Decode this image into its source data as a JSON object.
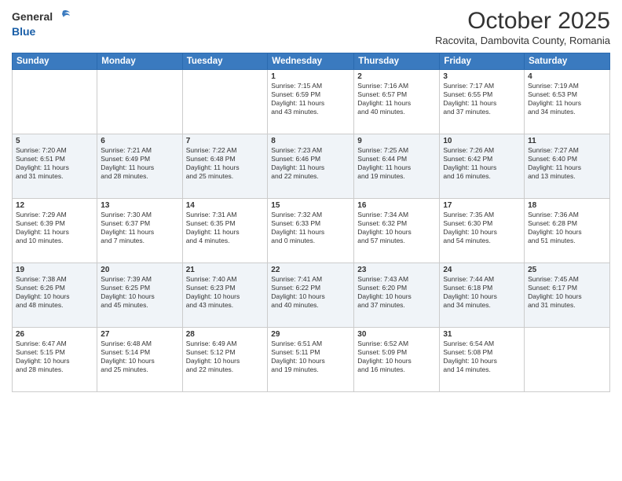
{
  "header": {
    "logo_line1": "General",
    "logo_line2": "Blue",
    "month": "October 2025",
    "location": "Racovita, Dambovita County, Romania"
  },
  "days_of_week": [
    "Sunday",
    "Monday",
    "Tuesday",
    "Wednesday",
    "Thursday",
    "Friday",
    "Saturday"
  ],
  "weeks": [
    [
      {
        "day": "",
        "info": ""
      },
      {
        "day": "",
        "info": ""
      },
      {
        "day": "",
        "info": ""
      },
      {
        "day": "1",
        "info": "Sunrise: 7:15 AM\nSunset: 6:59 PM\nDaylight: 11 hours\nand 43 minutes."
      },
      {
        "day": "2",
        "info": "Sunrise: 7:16 AM\nSunset: 6:57 PM\nDaylight: 11 hours\nand 40 minutes."
      },
      {
        "day": "3",
        "info": "Sunrise: 7:17 AM\nSunset: 6:55 PM\nDaylight: 11 hours\nand 37 minutes."
      },
      {
        "day": "4",
        "info": "Sunrise: 7:19 AM\nSunset: 6:53 PM\nDaylight: 11 hours\nand 34 minutes."
      }
    ],
    [
      {
        "day": "5",
        "info": "Sunrise: 7:20 AM\nSunset: 6:51 PM\nDaylight: 11 hours\nand 31 minutes."
      },
      {
        "day": "6",
        "info": "Sunrise: 7:21 AM\nSunset: 6:49 PM\nDaylight: 11 hours\nand 28 minutes."
      },
      {
        "day": "7",
        "info": "Sunrise: 7:22 AM\nSunset: 6:48 PM\nDaylight: 11 hours\nand 25 minutes."
      },
      {
        "day": "8",
        "info": "Sunrise: 7:23 AM\nSunset: 6:46 PM\nDaylight: 11 hours\nand 22 minutes."
      },
      {
        "day": "9",
        "info": "Sunrise: 7:25 AM\nSunset: 6:44 PM\nDaylight: 11 hours\nand 19 minutes."
      },
      {
        "day": "10",
        "info": "Sunrise: 7:26 AM\nSunset: 6:42 PM\nDaylight: 11 hours\nand 16 minutes."
      },
      {
        "day": "11",
        "info": "Sunrise: 7:27 AM\nSunset: 6:40 PM\nDaylight: 11 hours\nand 13 minutes."
      }
    ],
    [
      {
        "day": "12",
        "info": "Sunrise: 7:29 AM\nSunset: 6:39 PM\nDaylight: 11 hours\nand 10 minutes."
      },
      {
        "day": "13",
        "info": "Sunrise: 7:30 AM\nSunset: 6:37 PM\nDaylight: 11 hours\nand 7 minutes."
      },
      {
        "day": "14",
        "info": "Sunrise: 7:31 AM\nSunset: 6:35 PM\nDaylight: 11 hours\nand 4 minutes."
      },
      {
        "day": "15",
        "info": "Sunrise: 7:32 AM\nSunset: 6:33 PM\nDaylight: 11 hours\nand 0 minutes."
      },
      {
        "day": "16",
        "info": "Sunrise: 7:34 AM\nSunset: 6:32 PM\nDaylight: 10 hours\nand 57 minutes."
      },
      {
        "day": "17",
        "info": "Sunrise: 7:35 AM\nSunset: 6:30 PM\nDaylight: 10 hours\nand 54 minutes."
      },
      {
        "day": "18",
        "info": "Sunrise: 7:36 AM\nSunset: 6:28 PM\nDaylight: 10 hours\nand 51 minutes."
      }
    ],
    [
      {
        "day": "19",
        "info": "Sunrise: 7:38 AM\nSunset: 6:26 PM\nDaylight: 10 hours\nand 48 minutes."
      },
      {
        "day": "20",
        "info": "Sunrise: 7:39 AM\nSunset: 6:25 PM\nDaylight: 10 hours\nand 45 minutes."
      },
      {
        "day": "21",
        "info": "Sunrise: 7:40 AM\nSunset: 6:23 PM\nDaylight: 10 hours\nand 43 minutes."
      },
      {
        "day": "22",
        "info": "Sunrise: 7:41 AM\nSunset: 6:22 PM\nDaylight: 10 hours\nand 40 minutes."
      },
      {
        "day": "23",
        "info": "Sunrise: 7:43 AM\nSunset: 6:20 PM\nDaylight: 10 hours\nand 37 minutes."
      },
      {
        "day": "24",
        "info": "Sunrise: 7:44 AM\nSunset: 6:18 PM\nDaylight: 10 hours\nand 34 minutes."
      },
      {
        "day": "25",
        "info": "Sunrise: 7:45 AM\nSunset: 6:17 PM\nDaylight: 10 hours\nand 31 minutes."
      }
    ],
    [
      {
        "day": "26",
        "info": "Sunrise: 6:47 AM\nSunset: 5:15 PM\nDaylight: 10 hours\nand 28 minutes."
      },
      {
        "day": "27",
        "info": "Sunrise: 6:48 AM\nSunset: 5:14 PM\nDaylight: 10 hours\nand 25 minutes."
      },
      {
        "day": "28",
        "info": "Sunrise: 6:49 AM\nSunset: 5:12 PM\nDaylight: 10 hours\nand 22 minutes."
      },
      {
        "day": "29",
        "info": "Sunrise: 6:51 AM\nSunset: 5:11 PM\nDaylight: 10 hours\nand 19 minutes."
      },
      {
        "day": "30",
        "info": "Sunrise: 6:52 AM\nSunset: 5:09 PM\nDaylight: 10 hours\nand 16 minutes."
      },
      {
        "day": "31",
        "info": "Sunrise: 6:54 AM\nSunset: 5:08 PM\nDaylight: 10 hours\nand 14 minutes."
      },
      {
        "day": "",
        "info": ""
      }
    ]
  ],
  "row_classes": [
    "row-odd",
    "row-even",
    "row-odd",
    "row-even",
    "row-even"
  ]
}
